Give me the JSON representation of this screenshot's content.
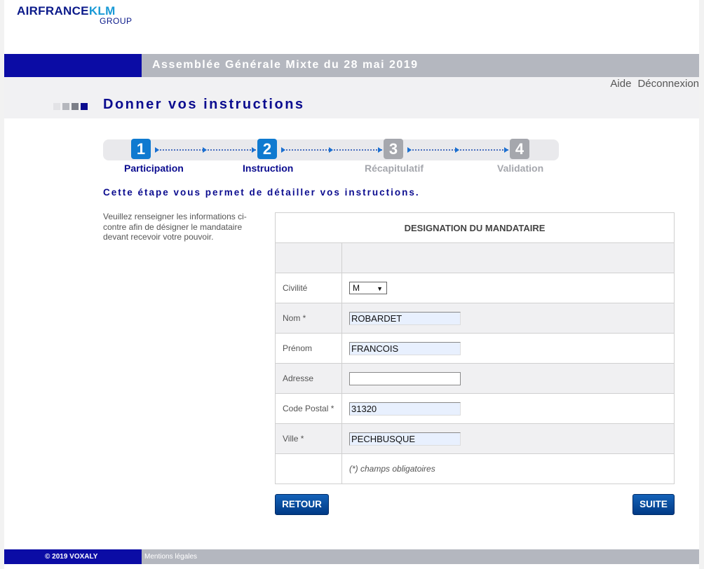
{
  "logo": {
    "brand_part1": "AIRFRANCE",
    "brand_part2": "KLM",
    "sub": "GROUP"
  },
  "banner": {
    "title": "Assemblée Générale Mixte du 28 mai 2019"
  },
  "top_links": {
    "help": "Aide",
    "logout": "Déconnexion"
  },
  "page_title": "Donner vos instructions",
  "steps": [
    {
      "number": "1",
      "label": "Participation",
      "state": "active"
    },
    {
      "number": "2",
      "label": "Instruction",
      "state": "active"
    },
    {
      "number": "3",
      "label": "Récapitulatif",
      "state": "inactive"
    },
    {
      "number": "4",
      "label": "Validation",
      "state": "inactive"
    }
  ],
  "intro": "Cette étape vous permet de détailler vos instructions.",
  "side_text": "Veuillez renseigner les informations ci-contre afin de désigner le mandataire devant recevoir votre pouvoir.",
  "form": {
    "header": "DESIGNATION DU MANDATAIRE",
    "civilite_label": "Civilité",
    "civilite_value": "M",
    "nom_label": "Nom *",
    "nom_value": "ROBARDET",
    "prenom_label": "Prénom",
    "prenom_value": "FRANCOIS",
    "adresse_label": "Adresse",
    "adresse_value": "",
    "code_postal_label": "Code Postal *",
    "code_postal_value": "31320",
    "ville_label": "Ville *",
    "ville_value": "PECHBUSQUE",
    "required_note": "(*) champs obligatoires"
  },
  "buttons": {
    "back": "RETOUR",
    "next": "SUITE"
  },
  "footer": {
    "copyright": "© 2019 VOXALY",
    "legal": "Mentions légales"
  },
  "colors": {
    "navy": "#0b0ca5",
    "active_step": "#0f7ad0",
    "inactive_step": "#a5a7ad",
    "banner_grey": "#b4b7bf"
  }
}
